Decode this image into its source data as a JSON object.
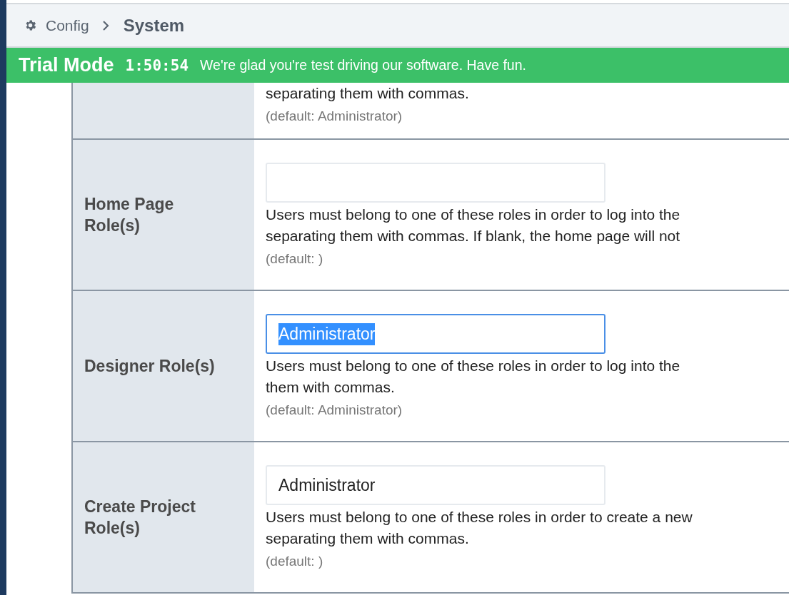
{
  "breadcrumb": {
    "parent": "Config",
    "current": "System"
  },
  "banner": {
    "title": "Trial Mode",
    "timer": "1:50:54",
    "message": "We're glad you're test driving our software. Have fun."
  },
  "settings": [
    {
      "kind": "partial",
      "lines": [
        "separating them with commas."
      ],
      "default": "(default: Administrator)"
    },
    {
      "kind": "field",
      "label": "Home Page Role(s)",
      "focused": false,
      "lines": [
        "Users must belong to one of these roles in order to log into the",
        "separating them with commas. If blank, the home page will not"
      ],
      "default": "(default: )"
    },
    {
      "kind": "field",
      "label": "Designer Role(s)",
      "value": "Administrator",
      "focused": true,
      "text_selected": true,
      "lines": [
        "Users must belong to one of these roles in order to log into the",
        "them with commas."
      ],
      "default": "(default: Administrator)"
    },
    {
      "kind": "field",
      "label": "Create Project Role(s)",
      "value": "Administrator",
      "focused": false,
      "text_selected": false,
      "lines": [
        "Users must belong to one of these roles in order to create a new",
        "separating them with commas."
      ],
      "default": "(default: )"
    }
  ]
}
